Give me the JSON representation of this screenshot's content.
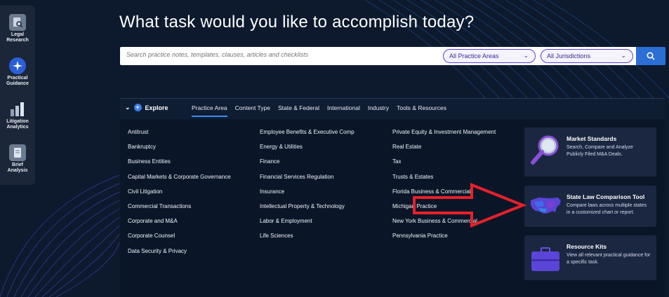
{
  "rail": {
    "items": [
      {
        "label": "Legal\nResearch",
        "icon": "search-doc-icon"
      },
      {
        "label": "Practical\nGuidance",
        "icon": "compass-star-icon"
      },
      {
        "label": "Litigation\nAnalytics",
        "icon": "bar-chart-icon"
      },
      {
        "label": "Brief\nAnalysis",
        "icon": "document-check-icon"
      }
    ]
  },
  "headline": "What task would you like to accomplish today?",
  "search": {
    "placeholder": "Search practice notes, templates, clauses, articles and checklists",
    "practice_area": "All Practice Areas",
    "jurisdiction": "All Jurisdictions",
    "button_icon": "search-icon"
  },
  "explore": {
    "label": "Explore",
    "tabs": [
      "Practice Area",
      "Content Type",
      "State & Federal",
      "International",
      "Industry",
      "Tools & Resources"
    ],
    "active_tab": "Practice Area",
    "columns": [
      [
        "Antitrust",
        "Bankruptcy",
        "Business Entities",
        "Capital Markets & Corporate Governance",
        "Civil Litigation",
        "Commercial Transactions",
        "Corporate and M&A",
        "Corporate Counsel",
        "Data Security & Privacy"
      ],
      [
        "Employee Benefits & Executive Comp",
        "Energy & Utilities",
        "Finance",
        "Financial Services Regulation",
        "Insurance",
        "Intellectual Property & Technology",
        "Labor & Employment",
        "Life Sciences"
      ],
      [
        "Private Equity & Investment Management",
        "Real Estate",
        "Tax",
        "Trusts & Estates",
        "Florida Business & Commercial",
        "Michigan Practice",
        "New York Business & Commercial",
        "Pennsylvania Practice"
      ]
    ]
  },
  "cards": [
    {
      "title": "Market Standards",
      "desc": "Search, Compare and Analyze Publicly Filed M&A Deals.",
      "icon": "magnifier-icon"
    },
    {
      "title": "State Law Comparison Tool",
      "desc": "Compare laws across multiple states in a customized chart or report.",
      "icon": "us-map-icon"
    },
    {
      "title": "Resource Kits",
      "desc": "View all relevant practical guidance for a specific task.",
      "icon": "briefcase-icon"
    }
  ],
  "colors": {
    "accent": "#3d8bff",
    "annotation": "#e8202a",
    "background": "#0d1a2e"
  }
}
